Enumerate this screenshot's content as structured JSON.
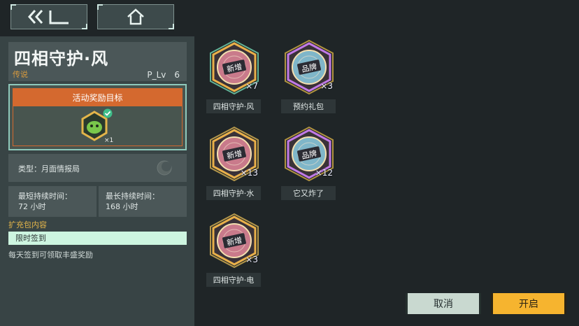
{
  "nav": {
    "back_icon": "back-arrow-icon",
    "home_icon": "home-icon"
  },
  "info": {
    "title": "四相守护·风",
    "rarity": "传说",
    "level": "P_Lv　6",
    "reward_header": "活动奖励目标",
    "reward_qty": "×1",
    "type_label": "类型：月面情报局",
    "min_duration_label": "最短持续时间：",
    "min_duration_value": "72 小时",
    "max_duration_label": "最长持续时间：",
    "max_duration_value": "168 小时",
    "expansion_label": "扩充包内容",
    "expansion_item": "限时签到",
    "expansion_desc": "每天签到可领取丰盛奖励"
  },
  "items": [
    {
      "label": "四相守护·风",
      "qty": "×7",
      "tag": "新增",
      "style": "gold-green"
    },
    {
      "label": "预约礼包",
      "qty": "×3",
      "tag": "品牌",
      "style": "purple"
    },
    {
      "label": "四相守护·水",
      "qty": "×13",
      "tag": "新增",
      "style": "gold"
    },
    {
      "label": "它又炸了",
      "qty": "×12",
      "tag": "品牌",
      "style": "purple"
    },
    {
      "label": "四相守护·电",
      "qty": "×3",
      "tag": "新增",
      "style": "gold"
    }
  ],
  "buttons": {
    "cancel": "取消",
    "open": "开启"
  },
  "colors": {
    "accent_orange": "#d4692f",
    "accent_gold": "#f6b42f",
    "rarity": "#d79a3e"
  }
}
